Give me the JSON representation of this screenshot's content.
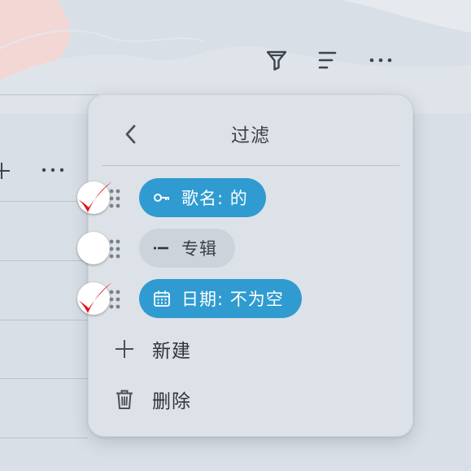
{
  "panel": {
    "title": "过滤",
    "filters": [
      {
        "label": "歌名: 的",
        "icon": "key-icon",
        "enabled": true
      },
      {
        "label": "专辑",
        "icon": "minus-icon",
        "enabled": false
      },
      {
        "label": "日期: 不为空",
        "icon": "calendar-icon",
        "enabled": true
      }
    ],
    "actions": {
      "new_label": "新建",
      "delete_label": "删除"
    }
  },
  "colors": {
    "accent": "#2f9bd0",
    "check": "#e0141c",
    "panel_bg": "#dde2e8"
  }
}
